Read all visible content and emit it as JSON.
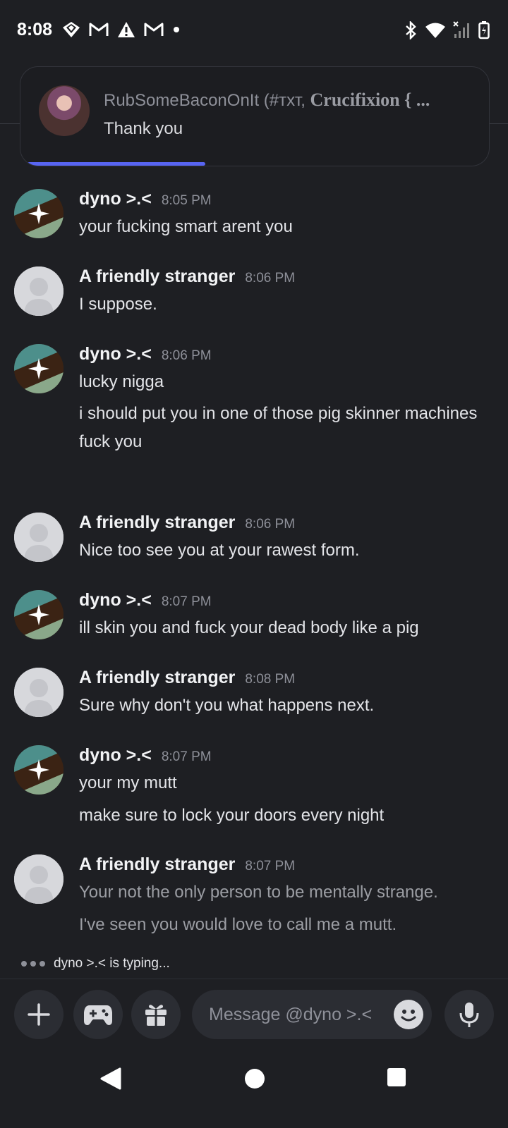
{
  "status_bar": {
    "time": "8:08",
    "left_icons": [
      "app-diamond-icon",
      "gmail-icon",
      "warning-icon",
      "gmail-icon",
      "dot-icon"
    ],
    "right_icons": [
      "bluetooth-icon",
      "wifi-icon",
      "signal-icon",
      "battery-icon"
    ]
  },
  "notification": {
    "title_prefix": "RubSomeBaconOnIt (#тхт, ",
    "title_bold": "Crucifixion { ...",
    "body": "Thank you",
    "progress": 0.38
  },
  "messages": [
    {
      "author": "dyno >.<",
      "avatar": "dyno",
      "time": "8:05 PM",
      "lines": [
        "your fucking smart arent you"
      ]
    },
    {
      "author": "A friendly stranger",
      "avatar": "stranger",
      "time": "8:06 PM",
      "lines": [
        "I suppose."
      ]
    },
    {
      "author": "dyno >.<",
      "avatar": "dyno",
      "time": "8:06 PM",
      "lines": [
        "lucky nigga",
        "i should put you in one of those pig skinner machines",
        "fuck you"
      ]
    },
    {
      "author": "A friendly stranger",
      "avatar": "stranger",
      "time": "8:06 PM",
      "lines": [
        "Nice too see you at your rawest form."
      ]
    },
    {
      "author": "dyno >.<",
      "avatar": "dyno",
      "time": "8:07 PM",
      "lines": [
        "ill skin you and fuck your dead body like a pig"
      ]
    },
    {
      "author": "A friendly stranger",
      "avatar": "stranger",
      "time": "8:08 PM",
      "lines": [
        "Sure why don't you what happens next."
      ]
    },
    {
      "author": "dyno >.<",
      "avatar": "dyno",
      "time": "8:07 PM",
      "lines": [
        "your my mutt",
        "make sure to lock your doors every night"
      ]
    },
    {
      "author": "A friendly stranger",
      "avatar": "stranger",
      "time": "8:07 PM",
      "lines": [
        "Your not the only person to be mentally strange.",
        "I've seen you would love to call me a mutt."
      ]
    }
  ],
  "typing_indicator": {
    "user": "dyno >.<",
    "text": " is typing..."
  },
  "composer": {
    "placeholder": "Message @dyno >.<",
    "buttons": [
      "plus-icon",
      "gamepad-icon",
      "gift-icon",
      "emoji-icon",
      "microphone-icon"
    ]
  },
  "nav_bar": [
    "back-icon",
    "home-icon",
    "recents-icon"
  ],
  "colors": {
    "accent": "#5865f2",
    "background": "#1e1f23",
    "input_bg": "#2b2d33"
  }
}
